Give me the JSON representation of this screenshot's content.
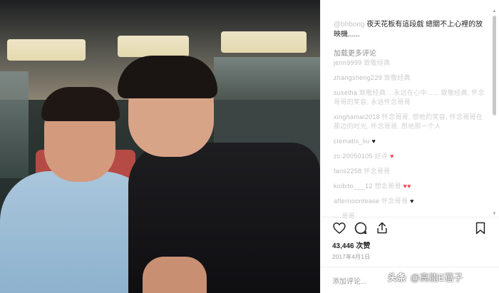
{
  "post": {
    "caption_user": "@bhbong",
    "caption_text": "夜天花板有這段戲 總關不上心裡的放映機......",
    "load_more": "加载更多评论",
    "comments": [
      {
        "user": "jenn9999",
        "text": "致敬经典"
      },
      {
        "user": "zhangsheng229",
        "text": "致敬经典"
      },
      {
        "user": "suxelha",
        "text": "致敬经典....永远在心中...... 致敬经典,  怀念哥哥的笑容,  永远怀念哥哥"
      },
      {
        "user": "xinghamai2018",
        "text": "怀念哥哥, 想他的笑容,  怀念哥哥在那边的时光, 怀念哥哥, 想他那一个人"
      },
      {
        "user": "clematis_liu",
        "text": "",
        "heart": true
      },
      {
        "user": "zc.20050105",
        "text": "好评",
        "heart": true
      },
      {
        "user": "fans2258",
        "text": "怀念哥哥"
      },
      {
        "user": "koibito___12",
        "text": "想念哥哥",
        "heart": true
      },
      {
        "user": "afternoontease",
        "text": "怀念哥哥"
      },
      {
        "user": "",
        "text": "....哥哥"
      }
    ],
    "likes": "43,446 次赞",
    "date": "2017年4月1日",
    "add_comment_placeholder": "添加评论..."
  },
  "watermark": {
    "icon": "头条",
    "text": "@高能E蓓子"
  },
  "icons": {
    "like": "heart-icon",
    "comment": "comment-bubble-icon",
    "share": "share-icon",
    "save": "bookmark-icon"
  },
  "colors": {
    "text": "#262626",
    "muted": "#8e8e8e",
    "heart": "#ed4956"
  }
}
